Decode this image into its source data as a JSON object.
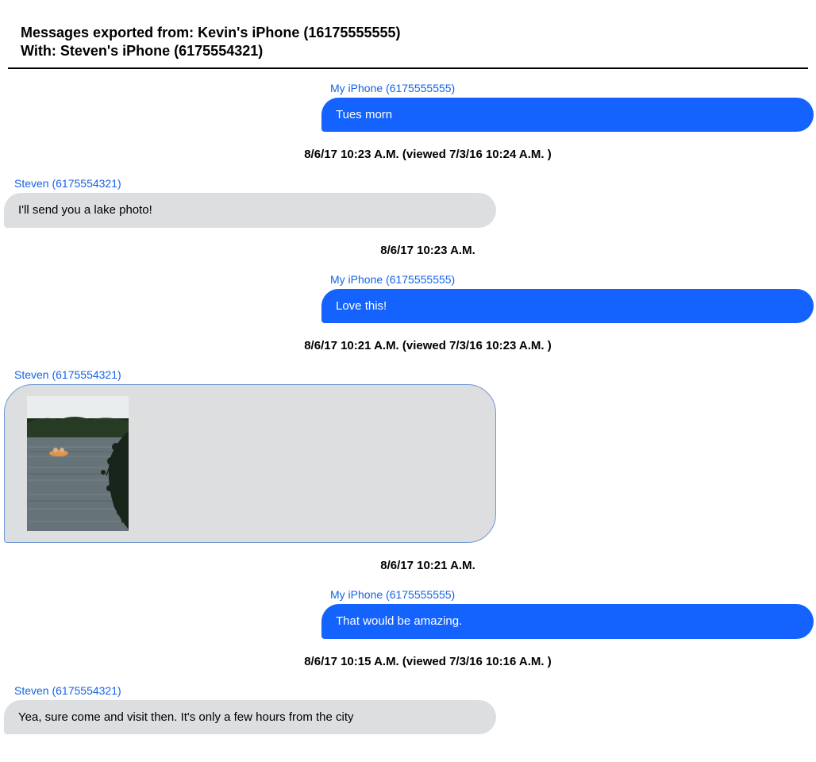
{
  "header": {
    "line1": "Messages exported from: Kevin's iPhone (16175555555)",
    "line2": "With: Steven's iPhone (6175554321)"
  },
  "labels": {
    "myPhone": "My iPhone (6175555555)",
    "steven": "Steven (6175554321)"
  },
  "messages": {
    "m1": {
      "text": "Tues morn"
    },
    "ts1": "8/6/17 10:23 A.M. (viewed 7/3/16 10:24 A.M. )",
    "m2": {
      "text": "I'll send you a lake photo!"
    },
    "ts2": "8/6/17 10:23 A.M.",
    "m3": {
      "text": "Love this!"
    },
    "ts3": "8/6/17 10:21 A.M. (viewed 7/3/16 10:23 A.M. )",
    "m4": {
      "image_alt": "lake-photo"
    },
    "ts4": "8/6/17 10:21 A.M.",
    "m5": {
      "text": "That would be amazing."
    },
    "ts5": "8/6/17 10:15 A.M. (viewed 7/3/16 10:16 A.M. )",
    "m6": {
      "text": "Yea, sure come and visit then. It's only a few hours from the city"
    }
  }
}
